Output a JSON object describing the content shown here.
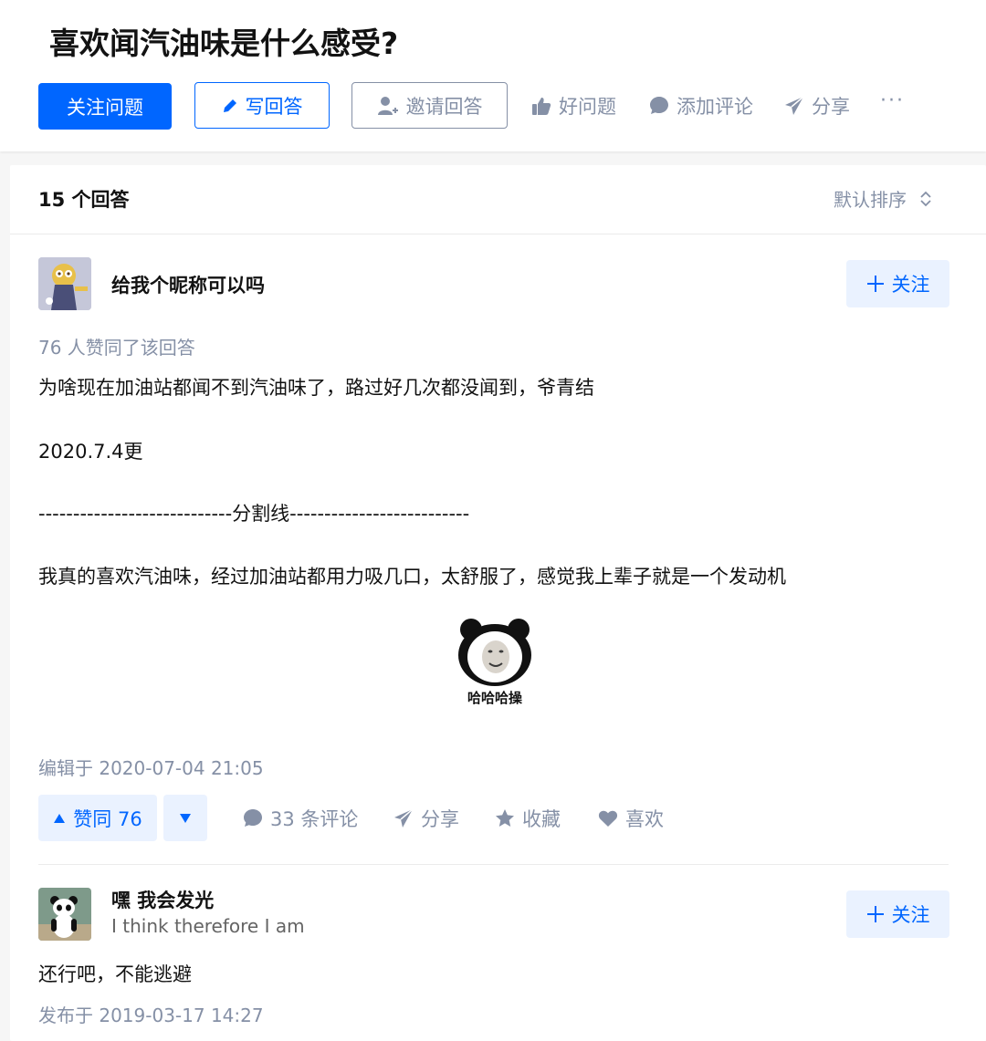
{
  "question": {
    "title": "喜欢闻汽油味是什么感受?",
    "follow_label": "关注问题",
    "write_label": "写回答",
    "invite_label": "邀请回答",
    "good_question_label": "好问题",
    "add_comment_label": "添加评论",
    "share_label": "分享",
    "more_label": "···"
  },
  "answers_header": {
    "count_label": "15 个回答",
    "sort_label": "默认排序"
  },
  "answer1": {
    "author_name": "给我个昵称可以吗",
    "follow_label": "关注",
    "voters_text": "76 人赞同了该回答",
    "paragraphs": [
      "为啥现在加油站都闻不到汽油味了，路过好几次都没闻到，爷青结",
      "2020.7.4更",
      "----------------------------分割线--------------------------",
      "我真的喜欢汽油味，经过加油站都用力吸几口，太舒服了，感觉我上辈子就是一个发动机"
    ],
    "sticker_caption": "哈哈哈操",
    "edited_text": "编辑于 2020-07-04 21:05",
    "vote_up_label": "赞同 76",
    "comments_label": "33 条评论",
    "share_label": "分享",
    "collect_label": "收藏",
    "like_label": "喜欢"
  },
  "answer2": {
    "author_name": "嘿 我会发光",
    "author_bio": "I think therefore I am",
    "follow_label": "关注",
    "content": "还行吧，不能逃避",
    "published_text": "发布于 2019-03-17 14:27"
  },
  "colors": {
    "brand_blue": "#0066ff",
    "light_blue": "#eaf2ff",
    "meta_gray": "#8590a6",
    "text": "#121212"
  },
  "icons": [
    "pencil-icon",
    "add-user-icon",
    "thumbs-up-icon",
    "comment-bubble-icon",
    "paper-plane-icon",
    "more-dots-icon",
    "sort-chevron-icon",
    "plus-icon",
    "triangle-up-icon",
    "triangle-down-icon",
    "star-icon",
    "heart-icon"
  ]
}
